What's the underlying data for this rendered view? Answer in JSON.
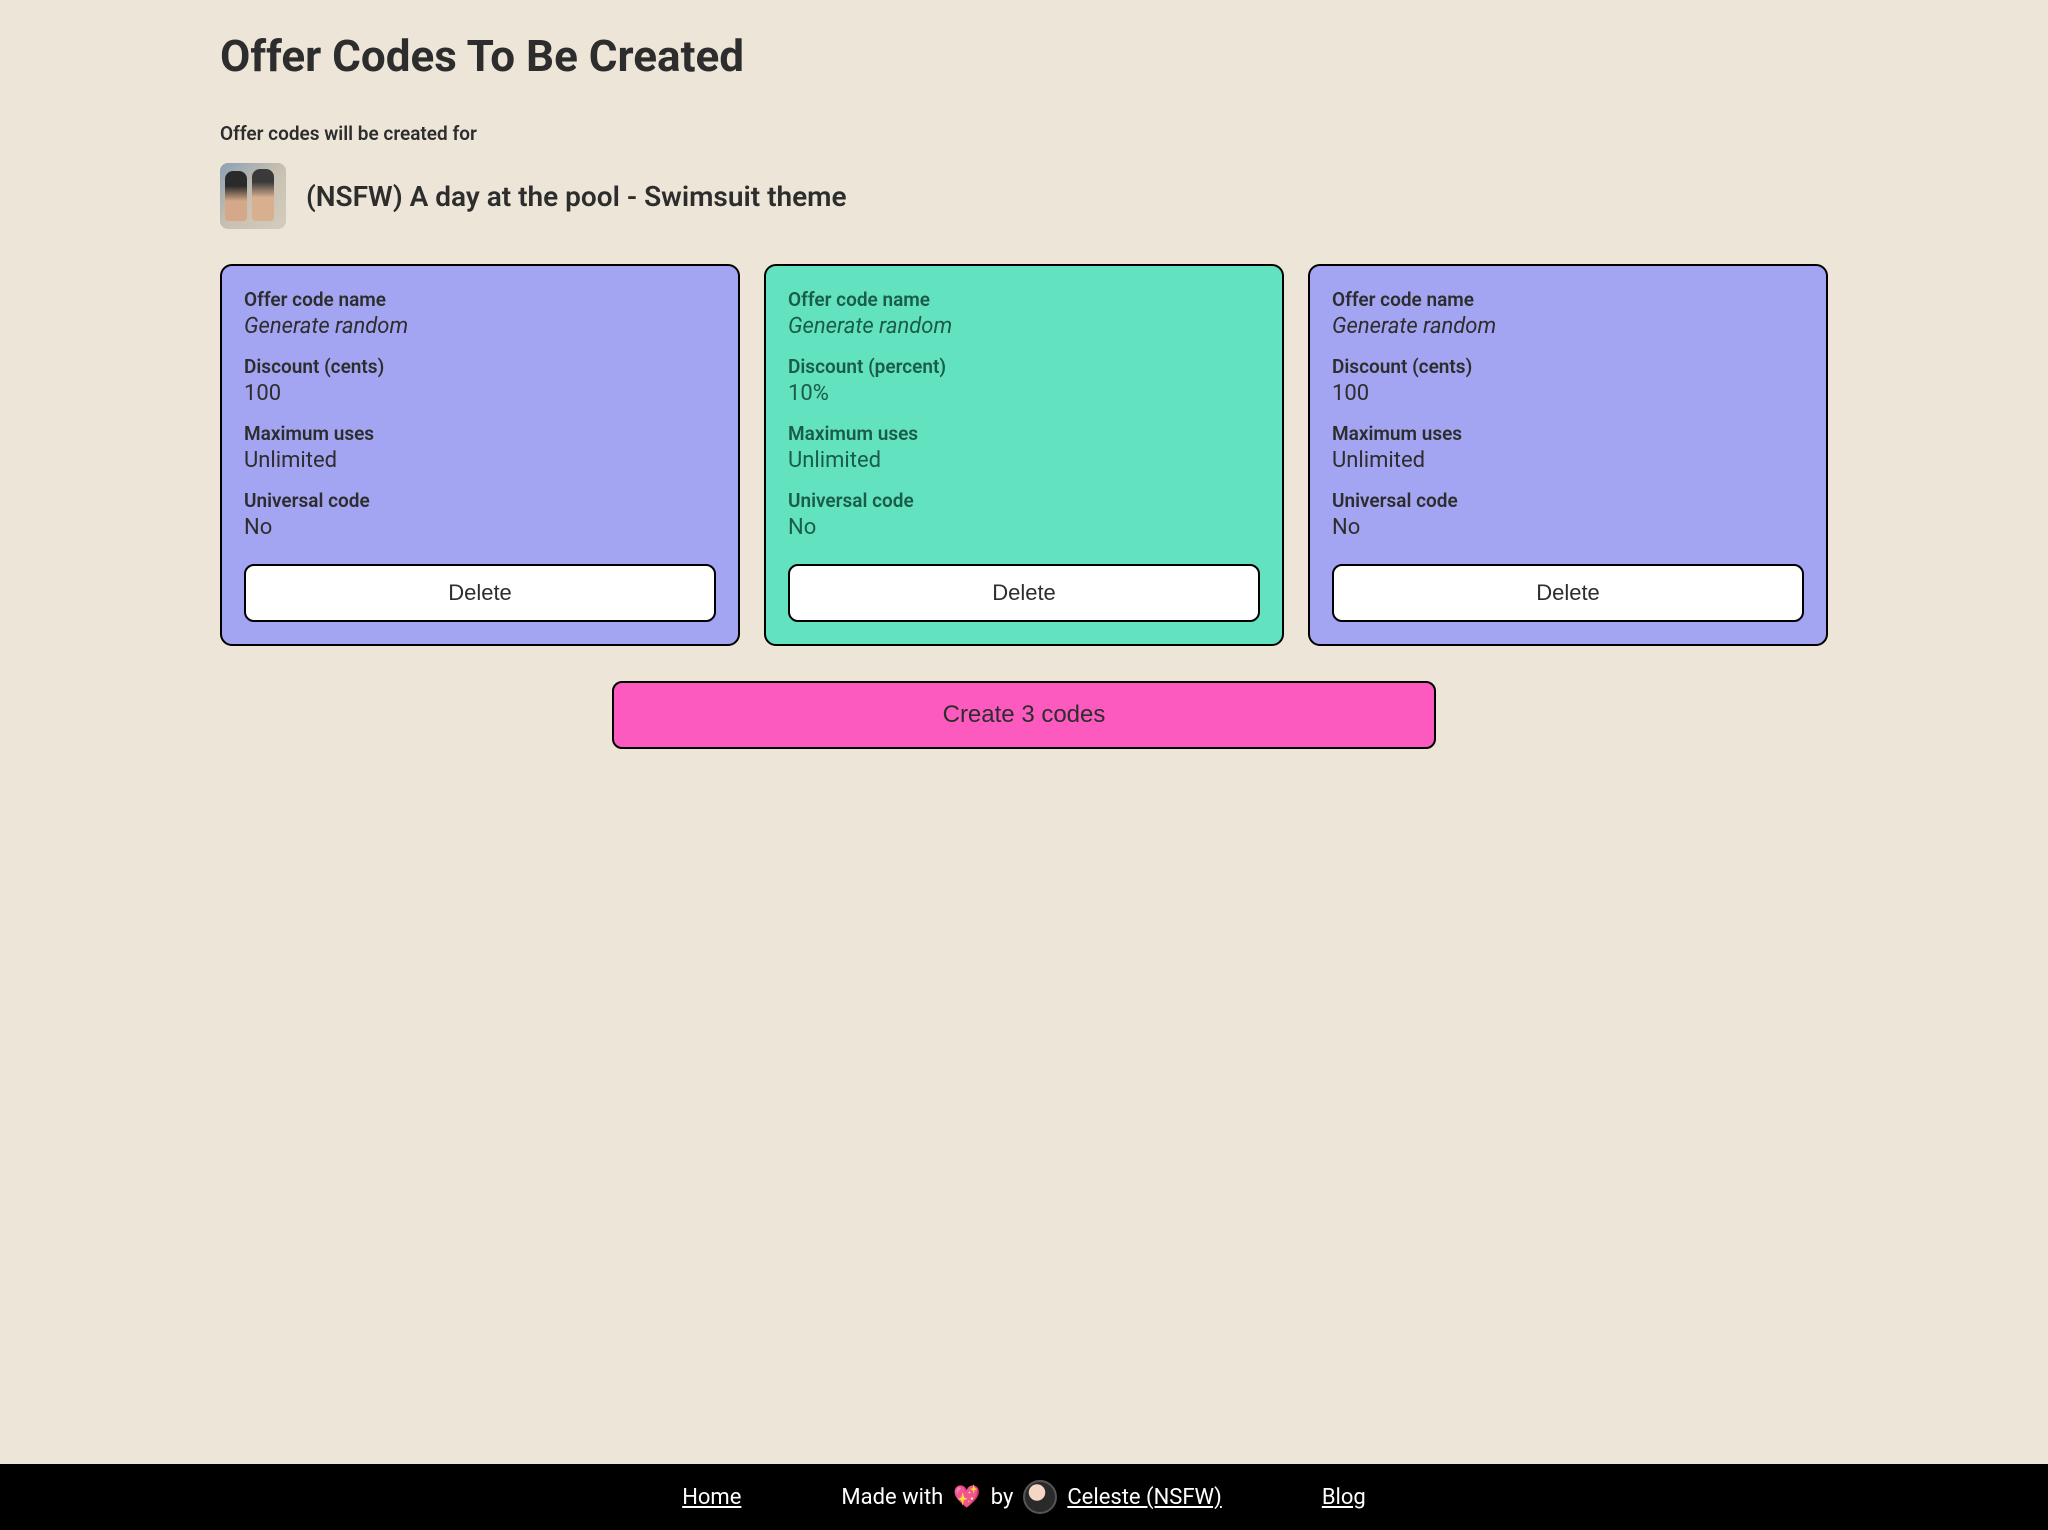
{
  "page": {
    "title": "Offer Codes To Be Created",
    "subtitle": "Offer codes will be created for",
    "product_title": "(NSFW) A day at the pool - Swimsuit theme"
  },
  "labels": {
    "offer_code_name": "Offer code name",
    "discount_cents": "Discount (cents)",
    "discount_percent": "Discount (percent)",
    "maximum_uses": "Maximum uses",
    "universal_code": "Universal code",
    "delete": "Delete"
  },
  "cards": [
    {
      "name_label": "Offer code name",
      "name_value": "Generate random",
      "discount_label": "Discount (cents)",
      "discount_value": "100",
      "max_uses_label": "Maximum uses",
      "max_uses_value": "Unlimited",
      "universal_label": "Universal code",
      "universal_value": "No"
    },
    {
      "name_label": "Offer code name",
      "name_value": "Generate random",
      "discount_label": "Discount (percent)",
      "discount_value": "10%",
      "max_uses_label": "Maximum uses",
      "max_uses_value": "Unlimited",
      "universal_label": "Universal code",
      "universal_value": "No"
    },
    {
      "name_label": "Offer code name",
      "name_value": "Generate random",
      "discount_label": "Discount (cents)",
      "discount_value": "100",
      "max_uses_label": "Maximum uses",
      "max_uses_value": "Unlimited",
      "universal_label": "Universal code",
      "universal_value": "No"
    }
  ],
  "actions": {
    "create_label": "Create 3 codes"
  },
  "footer": {
    "home": "Home",
    "made_with": "Made with",
    "by": "by",
    "author": "Celeste (NSFW)",
    "blog": "Blog"
  }
}
